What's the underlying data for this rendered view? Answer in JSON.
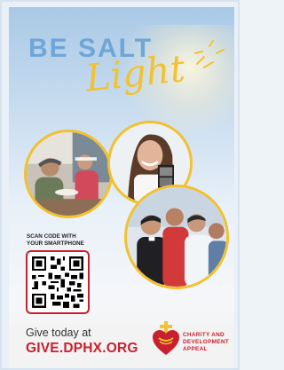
{
  "title": {
    "headline": "BE SALT",
    "script_word": "Light",
    "headline_color": "#6fa6d6",
    "script_color": "#f1c232"
  },
  "photos": [
    {
      "icon": "volunteers-serving-food-photo"
    },
    {
      "icon": "young-woman-holding-ultrasound-photo"
    },
    {
      "icon": "priest-and-young-men-photo"
    }
  ],
  "qr_section": {
    "line1": "SCAN CODE WITH",
    "line2": "YOUR SMARTPHONE",
    "icon": "qr-code"
  },
  "cta": {
    "give_text": "Give today at",
    "url": "GIVE.DPHX.ORG",
    "accent_color": "#c8202f"
  },
  "organization": {
    "logo_icon": "sacred-heart-cross-icon",
    "line1": "CHARITY AND",
    "line2": "DEVELOPMENT",
    "line3": "APPEAL"
  }
}
